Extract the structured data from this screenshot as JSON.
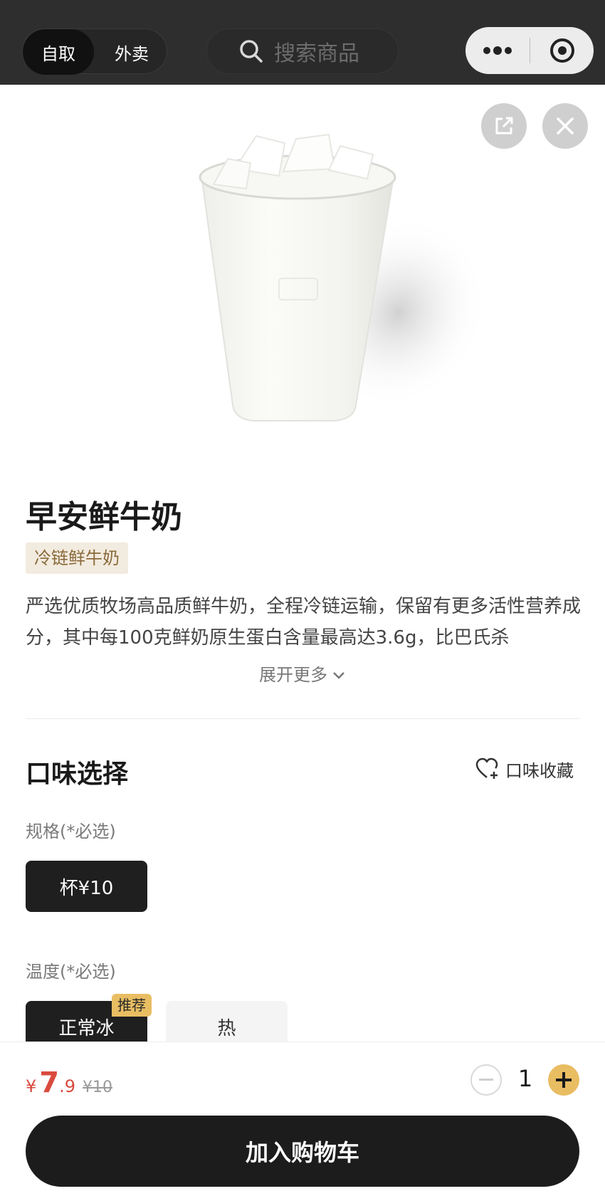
{
  "topbar": {
    "mode_active": "自取",
    "mode_inactive": "外卖",
    "search_placeholder": "搜索商品",
    "icons": {
      "search": "search-icon",
      "more": "more-dots-icon",
      "target": "target-icon"
    }
  },
  "hero": {
    "icons": {
      "share": "share-icon",
      "close": "close-icon"
    }
  },
  "product": {
    "name": "早安鲜牛奶",
    "tag": "冷链鲜牛奶",
    "description": "严选优质牧场高品质鲜牛奶，全程冷链运输，保留有更多活性营养成分，其中每100克鲜奶原生蛋白含量最高达3.6g，比巴氏杀",
    "expand_label": "展开更多"
  },
  "options": {
    "section_title": "口味选择",
    "favorite_label": "口味收藏",
    "groups": [
      {
        "label": "规格(*必选)",
        "choices": [
          {
            "label": "杯¥10",
            "selected": true
          }
        ]
      },
      {
        "label": "温度(*必选)",
        "choices": [
          {
            "label": "正常冰",
            "selected": true,
            "badge": "推荐"
          },
          {
            "label": "热",
            "selected": false
          }
        ]
      }
    ]
  },
  "bottom_bar": {
    "currency": "¥",
    "price_int": "7",
    "price_dec": ".9",
    "original_price": "¥10",
    "quantity": "1",
    "cart_label": "加入购物车"
  },
  "colors": {
    "topbar_bg": "#2e2e2e",
    "accent_gold": "#e9bd62",
    "price_red": "#d94a3e",
    "tag_bg": "#f2ebdf",
    "tag_text": "#8a6a3b"
  }
}
